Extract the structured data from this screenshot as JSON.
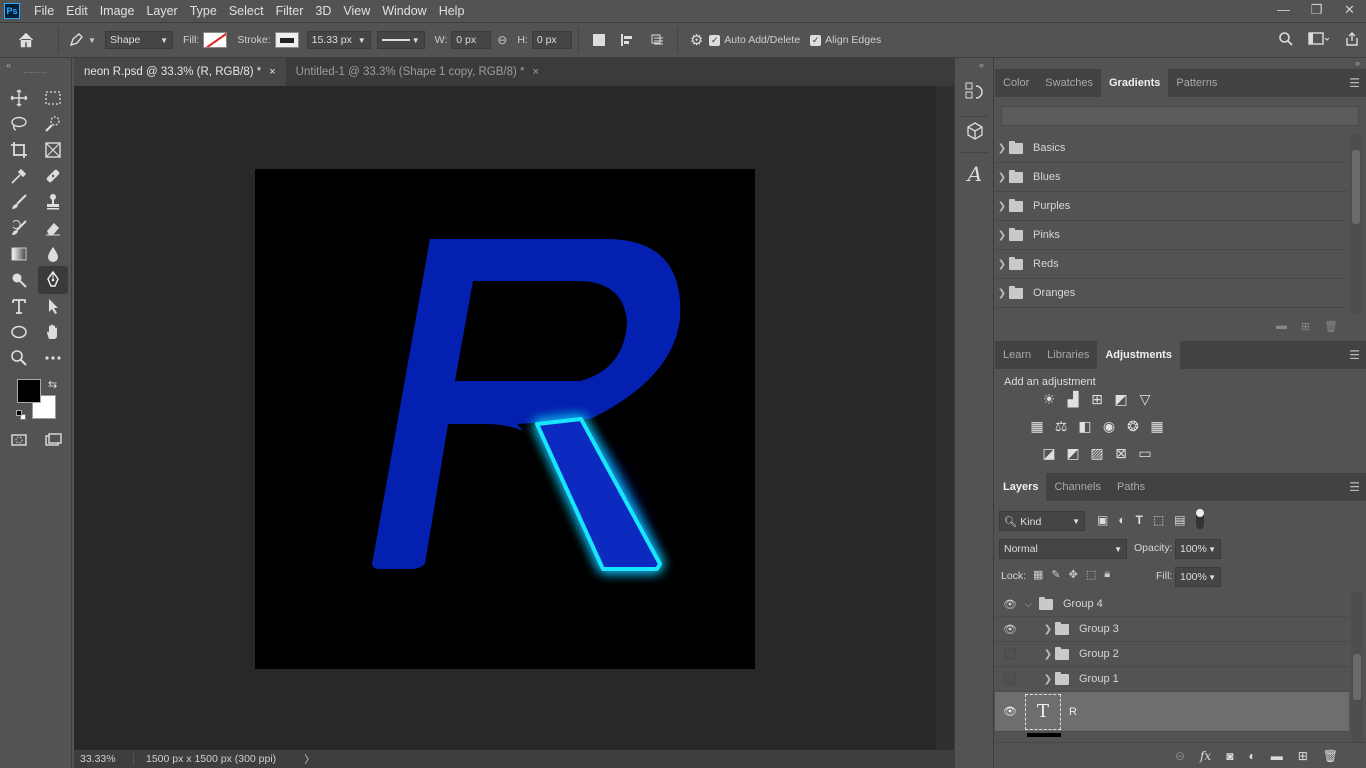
{
  "app": {
    "logo": "Ps"
  },
  "menu": [
    "File",
    "Edit",
    "Image",
    "Layer",
    "Type",
    "Select",
    "Filter",
    "3D",
    "View",
    "Window",
    "Help"
  ],
  "window_controls": {
    "minimize": "—",
    "restore": "❐",
    "close": "✕"
  },
  "options": {
    "mode": "Shape",
    "fill_label": "Fill:",
    "stroke_label": "Stroke:",
    "stroke_width": "15.33 px",
    "w_label": "W:",
    "w_value": "0 px",
    "h_label": "H:",
    "h_value": "0 px",
    "auto_add_delete": "Auto Add/Delete",
    "align_edges": "Align Edges"
  },
  "tabs": [
    {
      "label": "neon R.psd @ 33.3% (R, RGB/8) *",
      "active": true
    },
    {
      "label": "Untitled-1 @ 33.3% (Shape 1 copy, RGB/8) *",
      "active": false
    }
  ],
  "tab_close": "×",
  "status": {
    "zoom": "33.33%",
    "doc_info": "1500 px x 1500 px (300 ppi)",
    "arrow": "〉"
  },
  "colors": {
    "letter_fill": "#0420b0",
    "neon_stroke": "#19e6ff",
    "artboard": "#000000",
    "foreground": "#000000",
    "background": "#ffffff"
  },
  "gradients_panel": {
    "tabs": [
      "Color",
      "Swatches",
      "Gradients",
      "Patterns"
    ],
    "active_tab": "Gradients",
    "groups": [
      "Basics",
      "Blues",
      "Purples",
      "Pinks",
      "Reds",
      "Oranges"
    ]
  },
  "adjustments_panel": {
    "tabs": [
      "Learn",
      "Libraries",
      "Adjustments"
    ],
    "active_tab": "Adjustments",
    "heading": "Add an adjustment"
  },
  "layers_panel": {
    "tabs": [
      "Layers",
      "Channels",
      "Paths"
    ],
    "active_tab": "Layers",
    "filter_kind": "Kind",
    "blend_mode": "Normal",
    "opacity_label": "Opacity:",
    "opacity": "100%",
    "lock_label": "Lock:",
    "fill_label": "Fill:",
    "fill": "100%",
    "layers": [
      {
        "name": "Group 4",
        "visible": true,
        "expanded": true
      },
      {
        "name": "Group 3",
        "visible": true,
        "expanded": false
      },
      {
        "name": "Group 2",
        "visible": false,
        "expanded": false
      },
      {
        "name": "Group 1",
        "visible": false,
        "expanded": false
      },
      {
        "name": "R",
        "visible": true,
        "selected": true,
        "thumb": "T"
      }
    ]
  }
}
